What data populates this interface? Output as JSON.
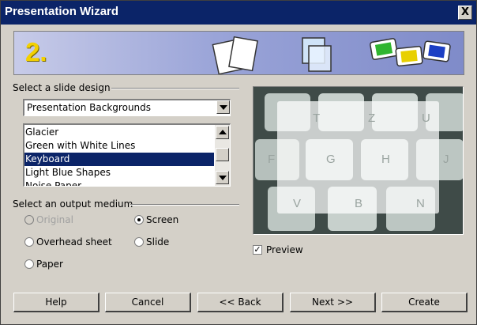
{
  "window": {
    "title": "Presentation Wizard",
    "close_glyph": "X"
  },
  "banner": {
    "step": "2."
  },
  "slide_design": {
    "label": "Select a slide design",
    "category": "Presentation Backgrounds",
    "items": [
      "Glacier",
      "Green with White Lines",
      "Keyboard",
      "Light Blue Shapes",
      "Noise Paper"
    ],
    "selected_index": 2
  },
  "output_medium": {
    "label": "Select an output medium",
    "options": [
      {
        "label": "Original",
        "checked": false,
        "enabled": false
      },
      {
        "label": "Screen",
        "checked": true,
        "enabled": true
      },
      {
        "label": "Overhead sheet",
        "checked": false,
        "enabled": true
      },
      {
        "label": "Slide",
        "checked": false,
        "enabled": true
      },
      {
        "label": "Paper",
        "checked": false,
        "enabled": true
      }
    ]
  },
  "preview": {
    "checkbox_label": "Preview",
    "checked": true,
    "keys_row1": [
      "T",
      "Z",
      "U"
    ],
    "keys_row2": [
      "F",
      "G",
      "H",
      "J"
    ],
    "keys_row3": [
      "V",
      "B",
      "N"
    ]
  },
  "buttons": {
    "help": "Help",
    "cancel": "Cancel",
    "back": "<< Back",
    "next": "Next >>",
    "create": "Create"
  },
  "colors": {
    "titlebar": "#0b2468",
    "selection": "#0b2468",
    "dialog_bg": "#d4d0c8"
  }
}
